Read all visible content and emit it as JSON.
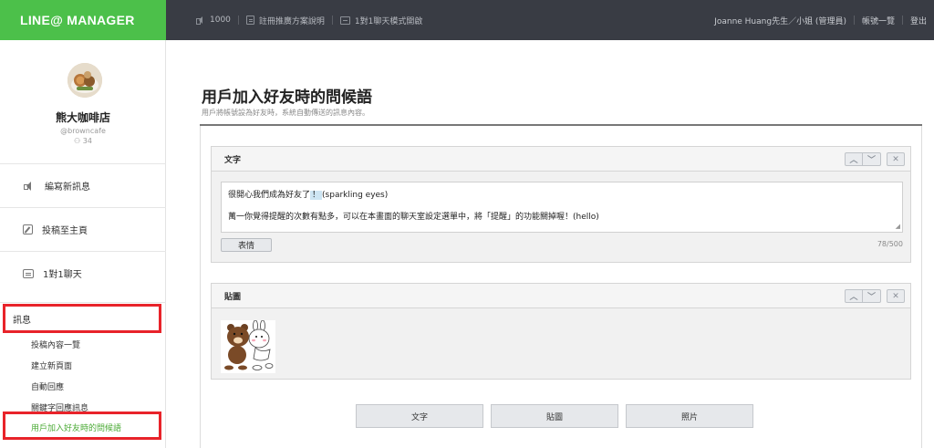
{
  "brand": "LINE@ MANAGER",
  "topnav": {
    "count": "1000",
    "plan_info": "註冊推廣方案說明",
    "chat_mode": "1對1聊天模式開啟"
  },
  "topright": {
    "user": "Joanne Huang先生／小姐 (管理員)",
    "account_list": "帳號一覽",
    "logout": "登出"
  },
  "profile": {
    "name": "熊大咖啡店",
    "id": "@browncafe",
    "friends": "34"
  },
  "sidebar": {
    "items": [
      {
        "label": "編寫新訊息",
        "icon": "speaker-icon"
      },
      {
        "label": "投稿至主頁",
        "icon": "edit-icon"
      },
      {
        "label": "1對1聊天",
        "icon": "chat-icon"
      }
    ],
    "section": "訊息",
    "subitems": [
      "投稿內容一覽",
      "建立新頁面",
      "自動回應",
      "關鍵字回應訊息",
      "用戶加入好友時的問候語"
    ]
  },
  "page": {
    "title": "用戶加入好友時的問候語",
    "subtitle": "用戶將帳號設為好友時，系統自動傳送的訊息內容。"
  },
  "text_panel": {
    "title": "文字",
    "line1_prefix": "很開心我們成為好友了",
    "line1_tag": "！",
    "line1_suffix": "(sparkling eyes)",
    "line2": "萬一你覺得提醒的次數有點多，可以在本畫面的聊天室設定選單中，將「提醒」的功能關掉喔！(hello)",
    "emoji_button": "表情",
    "counter": "78/500"
  },
  "sticker_panel": {
    "title": "貼圖"
  },
  "add_buttons": {
    "text": "文字",
    "sticker": "貼圖",
    "photo": "照片"
  },
  "colors": {
    "brand_green": "#4cc04a",
    "topbar": "#393c44",
    "highlight_red": "#e8232a",
    "active_green": "#4cab37"
  }
}
